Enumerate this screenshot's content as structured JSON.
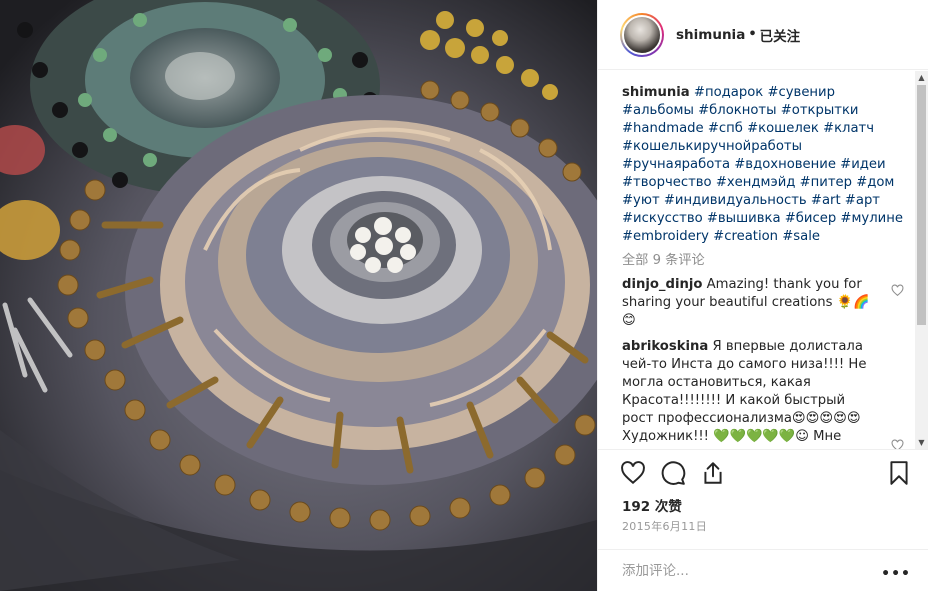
{
  "post": {
    "username": "shimunia",
    "separator": "•",
    "follow_status": "已关注",
    "caption": {
      "username": "shimunia",
      "text": "#подарок #сувенир #альбомы #блокноты #открытки #handmade #спб #кошелек #клатч #кошелькиручнойработы #ручнаяработа #вдохновение #идеи #творчество #хендмэйд #питер #дом #уют #индивидуальность #art #арт #искусство #вышивка #бисер #мулине #embroidery #creation #sale"
    },
    "view_all_comments": "全部 9 条评论",
    "comments": [
      {
        "username": "dinjo_dinjo",
        "text": "Amazing! thank you for sharing your beautiful creations 🌻🌈 😊"
      },
      {
        "username": "abrikoskina",
        "text": "Я впервые долистала чей-то Инста до самого низа!!!! Не могла остановиться, какая Красота!!!!!!!! И какой быстрый рост профессионализма😍😍😍😍😍 Художник!!! 💚💚💚💚💚☺ Мне"
      }
    ],
    "likes": "192 次赞",
    "date": "2015年6月11日",
    "add_comment_placeholder": "添加评论...",
    "more_options": "•••"
  },
  "icons": {
    "like": "heart-outline-icon",
    "comment": "comment-bubble-icon",
    "share": "share-upload-icon",
    "save": "bookmark-icon",
    "comment_like": "heart-outline-icon",
    "scroll_up": "▲",
    "scroll_down": "▼"
  },
  "colors": {
    "hashtag": "#003569",
    "muted": "#8e8e8e",
    "text": "#262626",
    "border": "#efefef"
  }
}
